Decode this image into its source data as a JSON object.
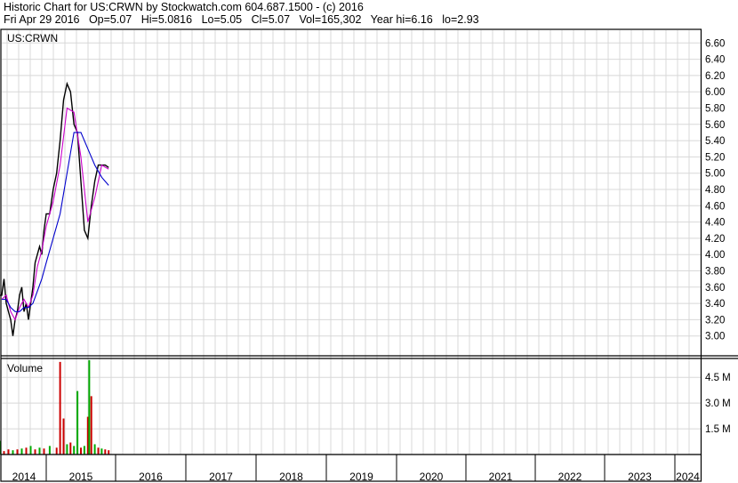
{
  "header": {
    "line1": "Historic Chart for US:CRWN by Stockwatch.com 604.687.1500 - (c) 2016",
    "date": "Fri Apr 29 2016",
    "open": "Op=5.07",
    "high": "Hi=5.0816",
    "low": "Lo=5.05",
    "close": "Cl=5.07",
    "volume": "Vol=165,302",
    "year_high": "Year hi=6.16",
    "year_low": "lo=2.93"
  },
  "chart_data": [
    {
      "type": "line",
      "title": "US:CRWN",
      "ylim": [
        2.8,
        6.8
      ],
      "yticks": [
        "6.60",
        "6.40",
        "6.20",
        "6.00",
        "5.80",
        "5.60",
        "5.40",
        "5.20",
        "5.00",
        "4.80",
        "4.60",
        "4.40",
        "4.20",
        "4.00",
        "3.80",
        "3.60",
        "3.40",
        "3.20",
        "3.00"
      ],
      "xlabels": [
        "2014",
        "2015",
        "2016",
        "2017",
        "2018",
        "2019",
        "2020",
        "2021",
        "2022",
        "2023",
        "2024"
      ],
      "grid": true,
      "colors": {
        "price": "#000000",
        "ma_short": "#cc00cc",
        "ma_long": "#0000cc"
      },
      "series": [
        {
          "key": "price",
          "x": [
            2013.92,
            2014.0,
            2014.05,
            2014.1,
            2014.15,
            2014.2,
            2014.25,
            2014.3,
            2014.35,
            2014.4,
            2014.45,
            2014.5,
            2014.55,
            2014.6,
            2014.65,
            2014.7,
            2014.75,
            2014.8,
            2014.85,
            2014.9,
            2014.95,
            2015.0,
            2015.05,
            2015.1,
            2015.15,
            2015.2,
            2015.25,
            2015.3,
            2015.35,
            2015.4,
            2015.45,
            2015.5,
            2015.55,
            2015.6,
            2015.65,
            2015.7,
            2015.75,
            2015.8,
            2015.85,
            2015.9
          ],
          "values": [
            3.5,
            3.5,
            3.7,
            3.4,
            3.3,
            3.2,
            3.0,
            3.2,
            3.3,
            3.5,
            3.6,
            3.3,
            3.4,
            3.2,
            3.4,
            3.6,
            3.9,
            4.0,
            4.1,
            4.0,
            4.3,
            4.5,
            4.5,
            4.8,
            5.0,
            5.4,
            5.9,
            6.1,
            6.0,
            5.6,
            5.5,
            4.9,
            4.3,
            4.2,
            4.6,
            4.9,
            5.1,
            5.1,
            5.1,
            5.07
          ]
        },
        {
          "key": "ma_short",
          "x": [
            2014.0,
            2014.1,
            2014.2,
            2014.3,
            2014.4,
            2014.5,
            2014.6,
            2014.7,
            2014.8,
            2014.9,
            2015.0,
            2015.1,
            2015.2,
            2015.3,
            2015.4,
            2015.5,
            2015.6,
            2015.7,
            2015.8,
            2015.9
          ],
          "values": [
            3.45,
            3.5,
            3.3,
            3.2,
            3.35,
            3.45,
            3.35,
            3.5,
            3.85,
            4.05,
            4.35,
            4.65,
            5.1,
            5.8,
            5.75,
            5.2,
            4.4,
            4.7,
            5.1,
            5.05
          ]
        },
        {
          "key": "ma_long",
          "x": [
            2014.0,
            2014.1,
            2014.2,
            2014.3,
            2014.4,
            2014.5,
            2014.6,
            2014.7,
            2014.8,
            2014.9,
            2015.0,
            2015.1,
            2015.2,
            2015.3,
            2015.4,
            2015.5,
            2015.6,
            2015.7,
            2015.8,
            2015.9
          ],
          "values": [
            3.45,
            3.45,
            3.35,
            3.3,
            3.3,
            3.35,
            3.35,
            3.4,
            3.55,
            3.7,
            3.9,
            4.2,
            4.5,
            5.0,
            5.5,
            5.5,
            5.3,
            5.1,
            4.95,
            4.85
          ]
        }
      ]
    },
    {
      "type": "bar",
      "title": "Volume",
      "ylim": [
        0,
        5600000
      ],
      "yticks": [
        "4.5 M",
        "3.0 M",
        "1.5 M"
      ],
      "colors": {
        "up": "#00aa00",
        "down": "#cc0000"
      },
      "x": [
        2013.95,
        2014.05,
        2014.15,
        2014.25,
        2014.35,
        2014.45,
        2014.55,
        2014.65,
        2014.75,
        2014.85,
        2014.95,
        2015.05,
        2015.15,
        2015.2,
        2015.25,
        2015.3,
        2015.35,
        2015.4,
        2015.45,
        2015.5,
        2015.55,
        2015.6,
        2015.62,
        2015.65,
        2015.7,
        2015.75,
        2015.8,
        2015.85,
        2015.9
      ],
      "values": [
        800000,
        200000,
        300000,
        250000,
        300000,
        350000,
        400000,
        500000,
        300000,
        400000,
        350000,
        500000,
        400000,
        5400000,
        2100000,
        600000,
        700000,
        500000,
        3700000,
        400000,
        500000,
        2200000,
        5500000,
        3400000,
        600000,
        400000,
        350000,
        300000,
        250000
      ],
      "direction": [
        "up",
        "down",
        "down",
        "up",
        "down",
        "up",
        "down",
        "up",
        "down",
        "up",
        "down",
        "up",
        "down",
        "down",
        "down",
        "up",
        "down",
        "up",
        "up",
        "down",
        "up",
        "down",
        "up",
        "down",
        "up",
        "down",
        "up",
        "down",
        "down"
      ]
    }
  ]
}
